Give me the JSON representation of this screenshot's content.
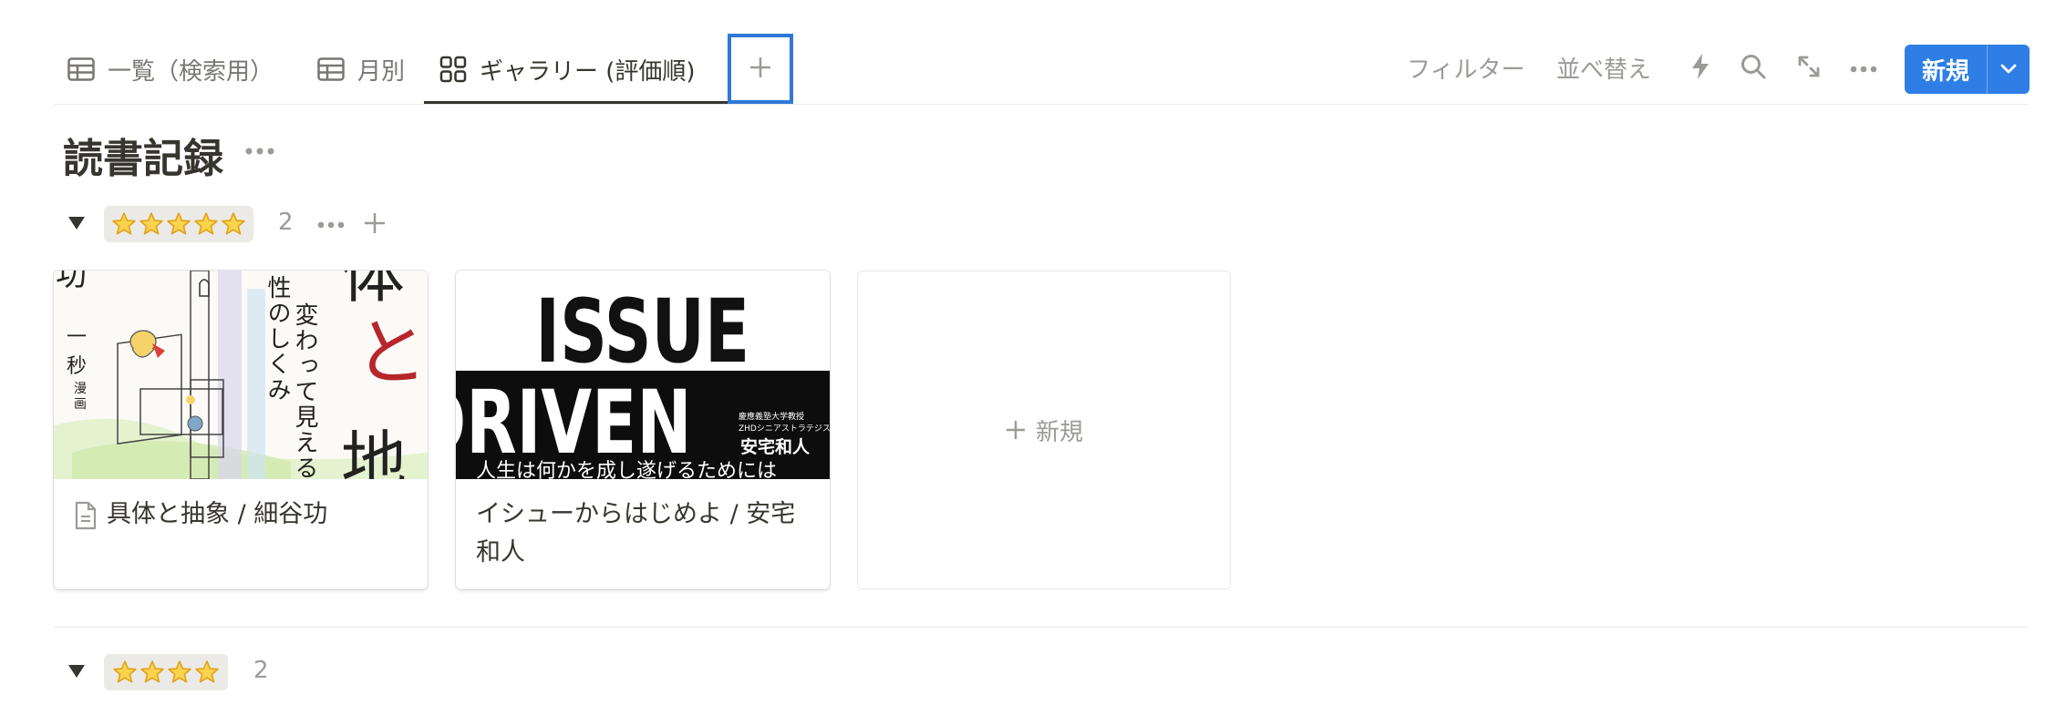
{
  "tabs": [
    {
      "label": "一覧（検索用）",
      "icon": "table-icon"
    },
    {
      "label": "月別",
      "icon": "table-icon"
    },
    {
      "label": "ギャラリー (評価順)",
      "icon": "gallery-icon",
      "active": true
    }
  ],
  "toolbar": {
    "filter_label": "フィルター",
    "sort_label": "並べ替え",
    "new_button_label": "新規",
    "icons": [
      "lightning-icon",
      "search-icon",
      "expand-icon",
      "more-icon",
      "chevron-down-icon"
    ]
  },
  "database": {
    "title": "読書記録"
  },
  "groups": [
    {
      "rating": "⭐⭐⭐⭐⭐",
      "star_count": 5,
      "count": "2",
      "cards": [
        {
          "title": "具体と抽象 / 細谷功",
          "has_page_icon": true
        },
        {
          "title": "イシューからはじめよ / 安宅和人",
          "title_line1": "イシューからはじめよ / 安宅",
          "title_line2": "和人",
          "has_page_icon": false
        }
      ],
      "new_card_label": "新規"
    },
    {
      "rating": "⭐⭐⭐⭐",
      "star_count": 4,
      "count": "2"
    }
  ],
  "covers": {
    "book1_vertical_text": [
      "変わって見える",
      "性のしくみ"
    ],
    "book1_side_chars": [
      "功",
      "一",
      "秒",
      "漫",
      "画"
    ],
    "book1_big_chars": [
      "体",
      "と",
      "地"
    ],
    "book2_lines": [
      "ISSUE",
      "DRIVEN"
    ],
    "book2_small_lines": [
      "慶應義塾大学教授",
      "ZHDシニアストラテジスト"
    ],
    "book2_author": "安宅和人",
    "book2_subtitle": "人生は何かを成し遂げるためには"
  },
  "colors": {
    "accent": "#2e7ee6",
    "highlight_border": "#2f78d8",
    "chip_bg": "#ebeae6",
    "text": "#37352f",
    "muted": "#9b9a97",
    "cover1_red": "#b8262b"
  }
}
